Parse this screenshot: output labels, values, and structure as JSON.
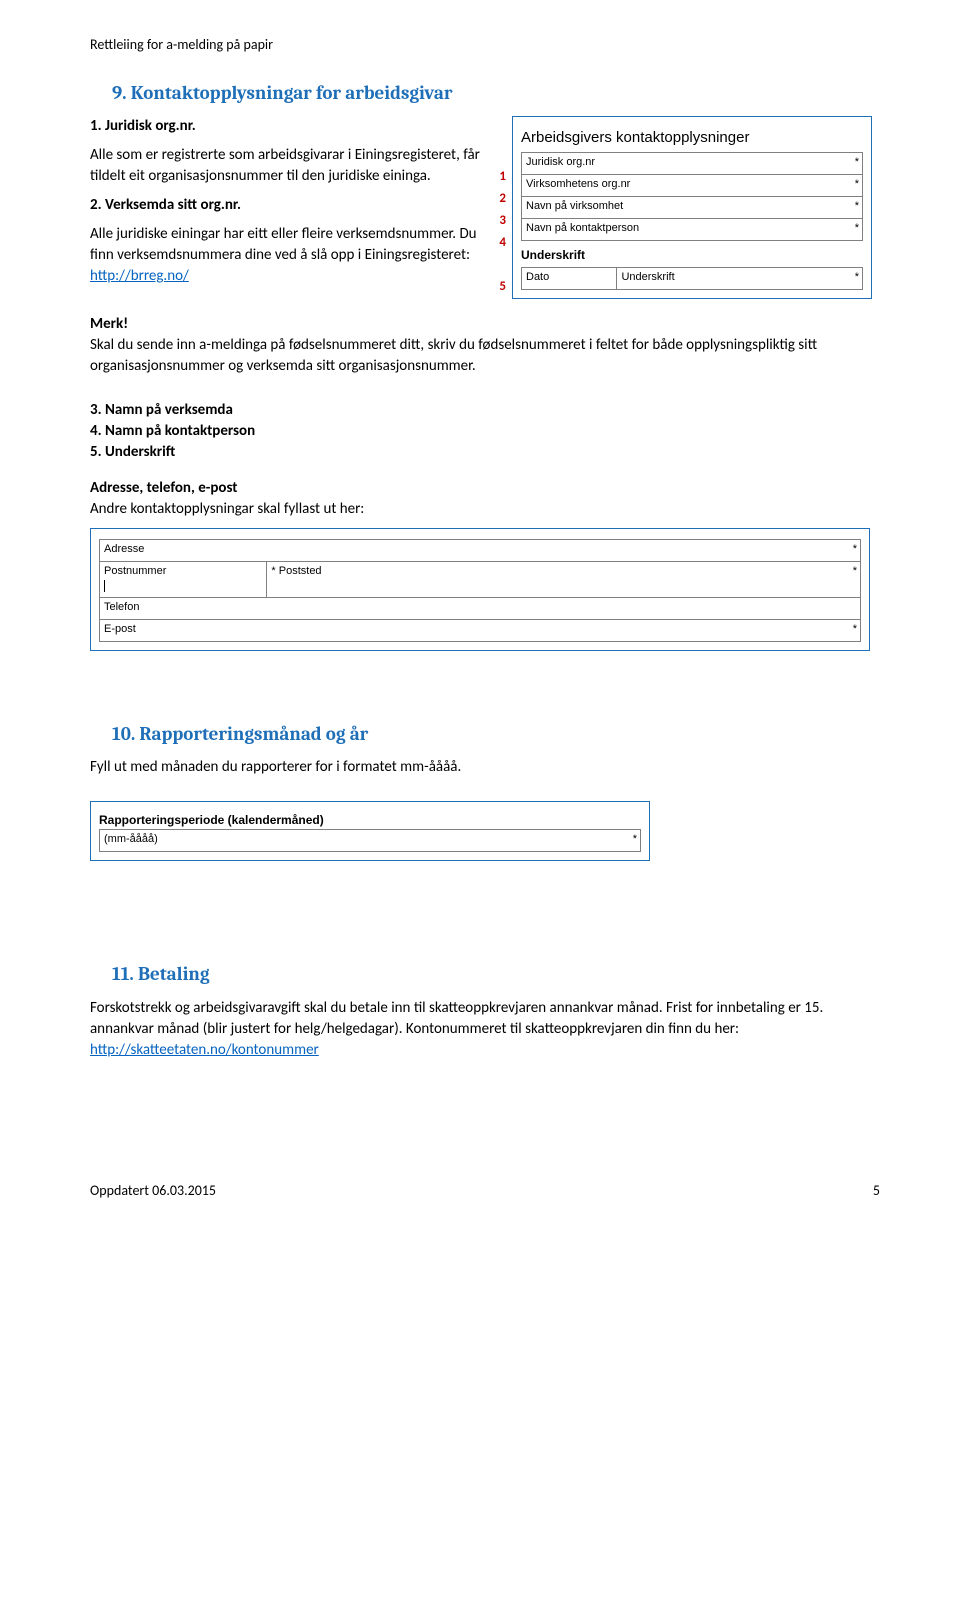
{
  "header": "Rettleiing for a-melding på papir",
  "s9": {
    "title": "9. Kontaktopplysningar for arbeidsgivar",
    "h1": "1. Juridisk org.nr.",
    "p1": "Alle som er registrerte som arbeidsgivarar i Einingsregisteret, får tildelt eit organisasjonsnummer til den juridiske eininga.",
    "h2": "2. Verksemda sitt org.nr.",
    "p2a": "Alle juridiske einingar har eitt eller fleire verksemdsnummer. Du finn verksemdsnummera dine ved å slå opp i Einingsregisteret:",
    "link1": "http://brreg.no/",
    "nums": [
      "1",
      "2",
      "3",
      "4",
      "5"
    ],
    "form": {
      "title": "Arbeidsgivers kontaktopplysninger",
      "r1": "Juridisk org.nr",
      "r2": "Virksomhetens org.nr",
      "r3": "Navn på virksomhet",
      "r4": "Navn på kontaktperson",
      "sub": "Underskrift",
      "d1": "Dato",
      "d2": "Underskrift"
    },
    "merk": "Merk!",
    "merk_p": "Skal du sende inn a-meldinga på fødselsnummeret ditt, skriv du fødselsnummeret i feltet for både opplysningspliktig sitt organisasjonsnummer og verksemda sitt organisasjonsnummer.",
    "l3": "3. Namn på verksemda",
    "l4": "4. Namn på kontaktperson",
    "l5": "5. Underskrift",
    "adr_h": "Adresse, telefon, e-post",
    "adr_p": "Andre kontaktopplysningar skal fyllast ut her:",
    "form2": {
      "adresse": "Adresse",
      "postnr": "Postnummer",
      "poststed": "Poststed",
      "telefon": "Telefon",
      "epost": "E-post",
      "star_prefix": "*"
    }
  },
  "s10": {
    "title": "10. Rapporteringsmånad og år",
    "p": "Fyll ut med månaden du rapporterer for i formatet mm-åååå.",
    "form": {
      "title": "Rapporteringsperiode (kalendermåned)",
      "val": "(mm-åååå)"
    }
  },
  "s11": {
    "title": "11. Betaling",
    "p1": "Forskotstrekk og arbeidsgivaravgift skal du betale inn til skatteoppkrevjaren annankvar månad. Frist for innbetaling er 15. annankvar månad (blir justert for helg/helgedagar). Kontonummeret til skatteoppkrevjaren din finn du her:",
    "link": "http://skatteetaten.no/kontonummer"
  },
  "footer": {
    "date": "Oppdatert 06.03.2015",
    "page": "5"
  }
}
